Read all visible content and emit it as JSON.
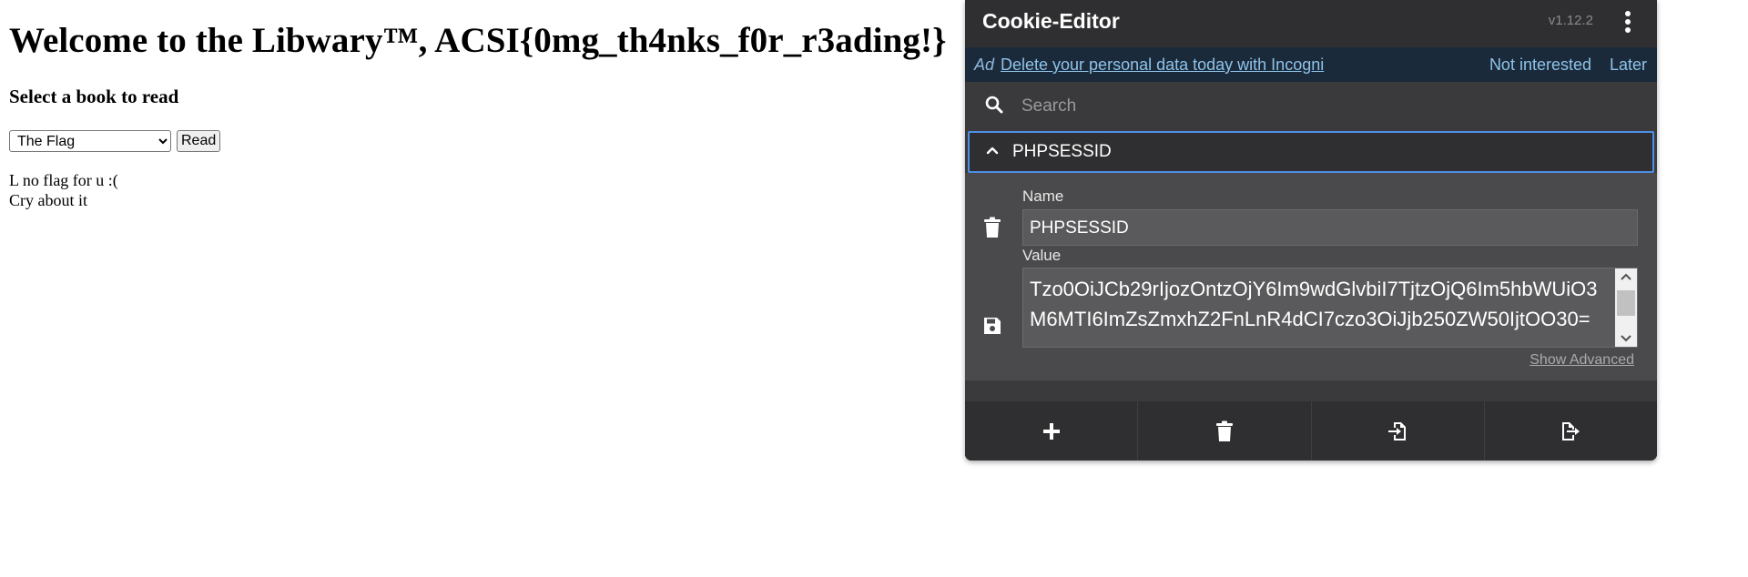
{
  "page": {
    "title": "Welcome to the Libwary™, ACSI{0mg_th4nks_f0r_r3ading!}",
    "subtitle": "Select a book to read",
    "select_value": "The Flag",
    "read_button": "Read",
    "message_line1": "L no flag for u :(",
    "message_line2": "Cry about it"
  },
  "cookie_editor": {
    "title": "Cookie-Editor",
    "version": "v1.12.2",
    "ad": {
      "label": "Ad",
      "link_text": "Delete your personal data today with Incogni",
      "not_interested": "Not interested",
      "later": "Later"
    },
    "search_placeholder": "Search",
    "cookie": {
      "header_name": "PHPSESSID",
      "name_label": "Name",
      "name_value": "PHPSESSID",
      "value_label": "Value",
      "value": "Tzo0OiJCb29rIjozOntzOjY6Im9wdGlvbiI7TjtzOjQ6Im5hbWUiO3M6MTI6ImZsZmxhZ2FnLnR4dCI7czo3OiJjb250ZW50IjtOO30=",
      "show_advanced": "Show Advanced"
    },
    "footer_buttons": [
      "add-icon",
      "trash-icon",
      "import-icon",
      "export-icon"
    ],
    "colors": {
      "panel_bg": "#3a3a3c",
      "header_bg": "#2f2f31",
      "ad_bg": "#1b2a3a",
      "link": "#8ec3ea",
      "focus_border": "#4f8fe6"
    }
  }
}
